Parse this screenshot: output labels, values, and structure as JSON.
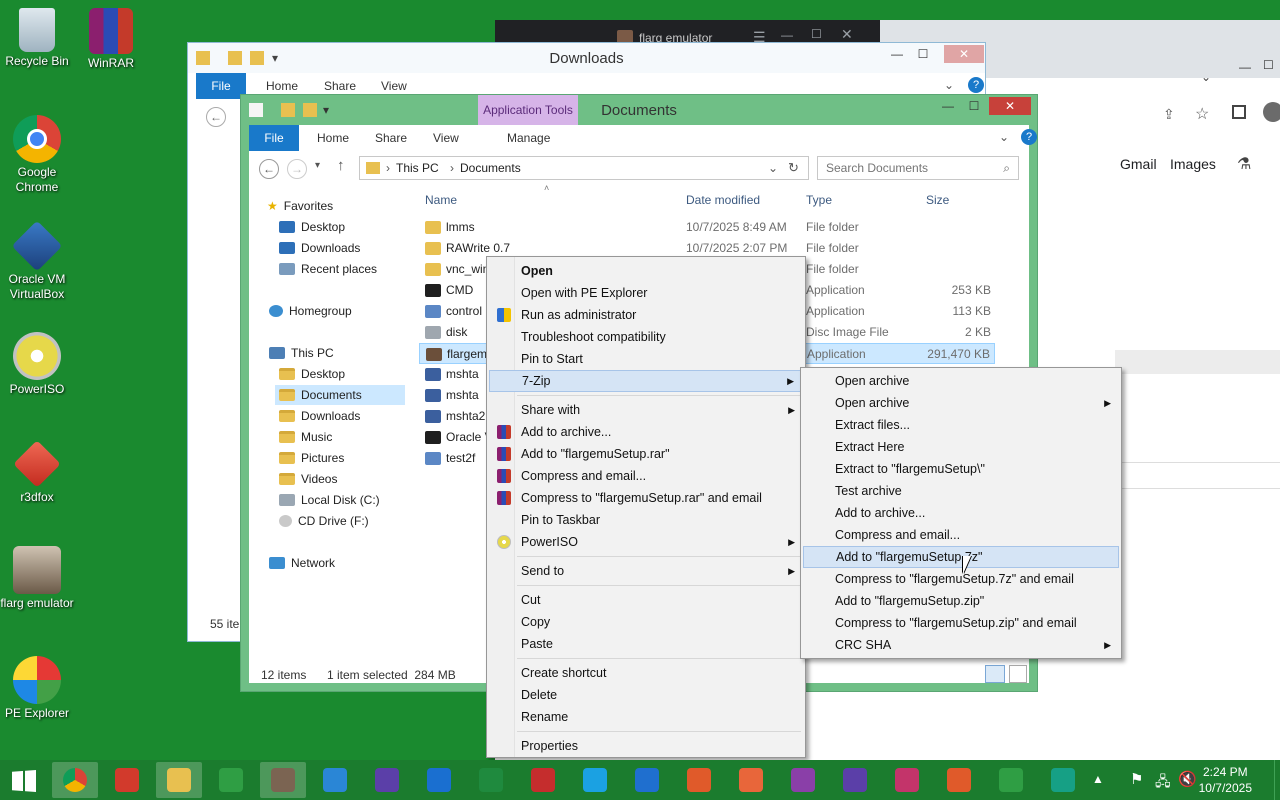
{
  "desktop": {
    "icons": [
      {
        "label": "Recycle Bin"
      },
      {
        "label": "WinRAR"
      },
      {
        "label": "Google Chrome"
      },
      {
        "label": "Oracle VM VirtualBox"
      },
      {
        "label": "PowerISO"
      },
      {
        "label": "r3dfox"
      },
      {
        "label": "flarg emulator"
      },
      {
        "label": "PE Explorer"
      }
    ]
  },
  "browser": {
    "tab_title": "flarg emulator",
    "links": [
      "Gmail",
      "Images"
    ]
  },
  "downloads_window": {
    "title": "Downloads",
    "tabs": [
      "File",
      "Home",
      "Share",
      "View"
    ],
    "status_count": "55 ite"
  },
  "documents_window": {
    "title": "Documents",
    "contextual_tab_group": "Application Tools",
    "tabs": [
      "File",
      "Home",
      "Share",
      "View",
      "Manage"
    ],
    "breadcrumb": [
      "This PC",
      "Documents"
    ],
    "search_placeholder": "Search Documents",
    "nav": {
      "favorites_label": "Favorites",
      "favorites": [
        "Desktop",
        "Downloads",
        "Recent places"
      ],
      "homegroup": "Homegroup",
      "thispc_label": "This PC",
      "thispc": [
        "Desktop",
        "Documents",
        "Downloads",
        "Music",
        "Pictures",
        "Videos",
        "Local Disk (C:)",
        "CD Drive (F:)"
      ],
      "network": "Network"
    },
    "columns": [
      "Name",
      "Date modified",
      "Type",
      "Size"
    ],
    "files": [
      {
        "name": "lmms",
        "date": "10/7/2025 8:49 AM",
        "type": "File folder",
        "size": ""
      },
      {
        "name": "RAWrite 0.7",
        "date": "10/7/2025 2:07 PM",
        "type": "File folder",
        "size": ""
      },
      {
        "name": "vnc_win",
        "date": "",
        "type": "File folder",
        "size": ""
      },
      {
        "name": "CMD",
        "date": "",
        "type": "Application",
        "size": "253 KB"
      },
      {
        "name": "control",
        "date": "",
        "type": "Application",
        "size": "113 KB"
      },
      {
        "name": "disk",
        "date": "",
        "type": "Disc Image File",
        "size": "2 KB"
      },
      {
        "name": "flargem",
        "date": "",
        "type": "Application",
        "size": "291,470 KB"
      },
      {
        "name": "mshta",
        "date": "",
        "type": "",
        "size": ""
      },
      {
        "name": "mshta",
        "date": "",
        "type": "",
        "size": ""
      },
      {
        "name": "mshta2",
        "date": "",
        "type": "",
        "size": ""
      },
      {
        "name": "Oracle V",
        "date": "",
        "type": "",
        "size": ""
      },
      {
        "name": "test2f",
        "date": "",
        "type": "",
        "size": ""
      }
    ],
    "status_items": "12 items",
    "status_selected": "1 item selected  284 MB"
  },
  "context_menu": {
    "items": [
      {
        "label": "Open",
        "bold": true
      },
      {
        "label": "Open with PE Explorer"
      },
      {
        "label": "Run as administrator",
        "icon": "uac-shield-icon"
      },
      {
        "label": "Troubleshoot compatibility"
      },
      {
        "label": "Pin to Start"
      },
      {
        "label": "7-Zip",
        "submenu": true,
        "highlighted": true
      },
      {
        "label": "Share with",
        "submenu": true
      },
      {
        "label": "Add to archive...",
        "icon": "winrar-icon"
      },
      {
        "label": "Add to \"flargemuSetup.rar\"",
        "icon": "winrar-icon"
      },
      {
        "label": "Compress and email...",
        "icon": "winrar-icon"
      },
      {
        "label": "Compress to \"flargemuSetup.rar\" and email",
        "icon": "winrar-icon"
      },
      {
        "label": "Pin to Taskbar"
      },
      {
        "label": "PowerISO",
        "submenu": true,
        "icon": "poweriso-icon"
      },
      {
        "label": "Send to",
        "submenu": true
      },
      {
        "label": "Cut"
      },
      {
        "label": "Copy"
      },
      {
        "label": "Paste"
      },
      {
        "label": "Create shortcut"
      },
      {
        "label": "Delete"
      },
      {
        "label": "Rename"
      },
      {
        "label": "Properties"
      }
    ]
  },
  "submenu_7zip": {
    "items": [
      {
        "label": "Open archive"
      },
      {
        "label": "Open archive",
        "submenu": true
      },
      {
        "label": "Extract files..."
      },
      {
        "label": "Extract Here"
      },
      {
        "label": "Extract to \"flargemuSetup\\\""
      },
      {
        "label": "Test archive"
      },
      {
        "label": "Add to archive..."
      },
      {
        "label": "Compress and email..."
      },
      {
        "label": "Add to \"flargemuSetup.7z\"",
        "highlighted": true
      },
      {
        "label": "Compress to \"flargemuSetup.7z\" and email"
      },
      {
        "label": "Add to \"flargemuSetup.zip\""
      },
      {
        "label": "Compress to \"flargemuSetup.zip\" and email"
      },
      {
        "label": "CRC SHA",
        "submenu": true
      }
    ]
  },
  "taskbar": {
    "time": "2:24 PM",
    "date": "10/7/2025"
  },
  "colors": {
    "desktop": "#1a8a2f",
    "file_tab": "#1979ca",
    "menu_highlight": "#d5e4f5",
    "selection": "#cce8ff"
  }
}
